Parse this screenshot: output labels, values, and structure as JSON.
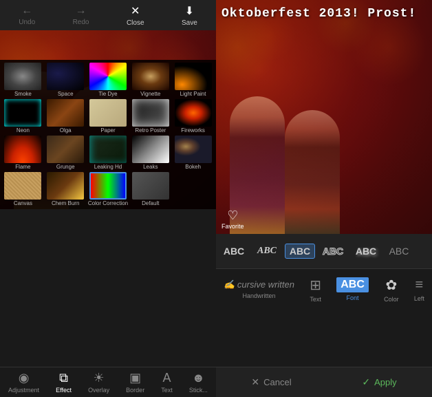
{
  "toolbar": {
    "undo_label": "Undo",
    "redo_label": "Redo",
    "close_label": "Close",
    "save_label": "Save"
  },
  "effects": [
    {
      "id": "smoke",
      "label": "Smoke",
      "class": "smoke"
    },
    {
      "id": "space",
      "label": "Space",
      "class": "space"
    },
    {
      "id": "tiedye",
      "label": "Tie Dye",
      "class": "tiedye"
    },
    {
      "id": "vignette",
      "label": "Vignette",
      "class": "vignette"
    },
    {
      "id": "lightpaint",
      "label": "Light Paint",
      "class": "lightpaint"
    },
    {
      "id": "neon",
      "label": "Neon",
      "class": "neon"
    },
    {
      "id": "olga",
      "label": "Olga",
      "class": "olga"
    },
    {
      "id": "paper",
      "label": "Paper",
      "class": "paper"
    },
    {
      "id": "retroposter",
      "label": "Retro Poster",
      "class": "retroposter"
    },
    {
      "id": "fireworks",
      "label": "Fireworks",
      "class": "fireworks"
    },
    {
      "id": "flame",
      "label": "Flame",
      "class": "flame"
    },
    {
      "id": "grunge",
      "label": "Grunge",
      "class": "grunge"
    },
    {
      "id": "leakinghd",
      "label": "Leaking Hd",
      "class": "leakinghd"
    },
    {
      "id": "leaks",
      "label": "Leaks",
      "class": "leaks"
    },
    {
      "id": "bokeh",
      "label": "Bokeh",
      "class": "bokeh"
    },
    {
      "id": "canvas",
      "label": "Canvas",
      "class": "canvas"
    },
    {
      "id": "chemburn",
      "label": "Chem Burn",
      "class": "chemburn"
    },
    {
      "id": "colorcorrection",
      "label": "Color Correction",
      "class": "colorcorrection"
    },
    {
      "id": "default",
      "label": "Default",
      "class": "default"
    }
  ],
  "bottom_tools_left": [
    {
      "id": "adjustment",
      "label": "Adjustment",
      "icon": "⬤"
    },
    {
      "id": "effect",
      "label": "Effect",
      "icon": "⧉"
    },
    {
      "id": "overlay",
      "label": "Overlay",
      "icon": "☀"
    },
    {
      "id": "border",
      "label": "Border",
      "icon": "▣"
    },
    {
      "id": "text",
      "label": "Text",
      "icon": "A"
    },
    {
      "id": "sticker",
      "label": "Stick...",
      "icon": "☻"
    }
  ],
  "photo_text": "Oktoberfest 2013! Prost!",
  "favorite_label": "Favorite",
  "fonts": [
    {
      "id": "handwritten",
      "label": "Handwritten",
      "preview": "ABC",
      "style": "handwritten"
    },
    {
      "id": "text",
      "label": "Text",
      "preview": "ABC",
      "style": "text"
    },
    {
      "id": "font1",
      "label": "Font",
      "preview": "ABC",
      "style": "selected"
    },
    {
      "id": "color",
      "label": "Color",
      "preview": "ABC",
      "style": "color"
    },
    {
      "id": "left",
      "label": "Left",
      "preview": "≡",
      "style": "align"
    }
  ],
  "font_styles": [
    {
      "id": "s1",
      "preview": "ABC",
      "style": "plain"
    },
    {
      "id": "s2",
      "preview": "ABC",
      "style": "italic"
    },
    {
      "id": "s3",
      "preview": "ABC",
      "style": "bold"
    },
    {
      "id": "s4",
      "preview": "ABC",
      "style": "outline"
    },
    {
      "id": "s5",
      "preview": "ABC",
      "style": "shadow"
    },
    {
      "id": "s6",
      "preview": "ABC",
      "style": "light"
    }
  ],
  "text_controls": [
    {
      "id": "handwritten",
      "label": "Handwritten",
      "icon": "✍"
    },
    {
      "id": "text_btn",
      "label": "Text",
      "icon": "⊞"
    },
    {
      "id": "font_btn",
      "label": "Font",
      "preview": "ABC"
    },
    {
      "id": "color_btn",
      "label": "Color",
      "icon": "✿"
    },
    {
      "id": "left_btn",
      "label": "Left",
      "icon": "≡"
    }
  ],
  "action_bar": {
    "cancel_label": "Cancel",
    "apply_label": "Apply"
  }
}
